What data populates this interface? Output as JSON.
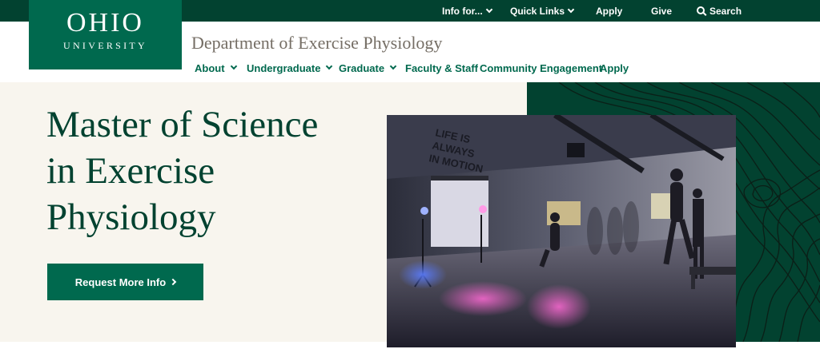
{
  "utility_nav": {
    "info_for": "Info for...",
    "quick_links": "Quick Links",
    "apply": "Apply",
    "give": "Give",
    "search": "Search"
  },
  "logo": {
    "line1": "OHIO",
    "line2": "UNIVERSITY"
  },
  "department_title": "Department of Exercise Physiology",
  "main_nav": {
    "about": "About",
    "undergraduate": "Undergraduate",
    "graduate": "Graduate",
    "faculty_staff": "Faculty & Staff",
    "community_engagement": "Community Engagement",
    "apply": "Apply"
  },
  "hero": {
    "headline_line1": "Master of Science",
    "headline_line2": "in Exercise",
    "headline_line3": "Physiology",
    "cta_label": "Request More Info",
    "wall_text_line1": "LIFE IS",
    "wall_text_line2": "ALWAYS",
    "wall_text_line3": "IN MOTION"
  },
  "colors": {
    "brand_dark_green": "#024230",
    "brand_green": "#00694e",
    "cream": "#f8f5ee",
    "taupe": "#756e65"
  },
  "icons": {
    "dropdown": "chevron-down-icon",
    "search": "search-icon",
    "cta_arrow": "chevron-right-icon"
  }
}
